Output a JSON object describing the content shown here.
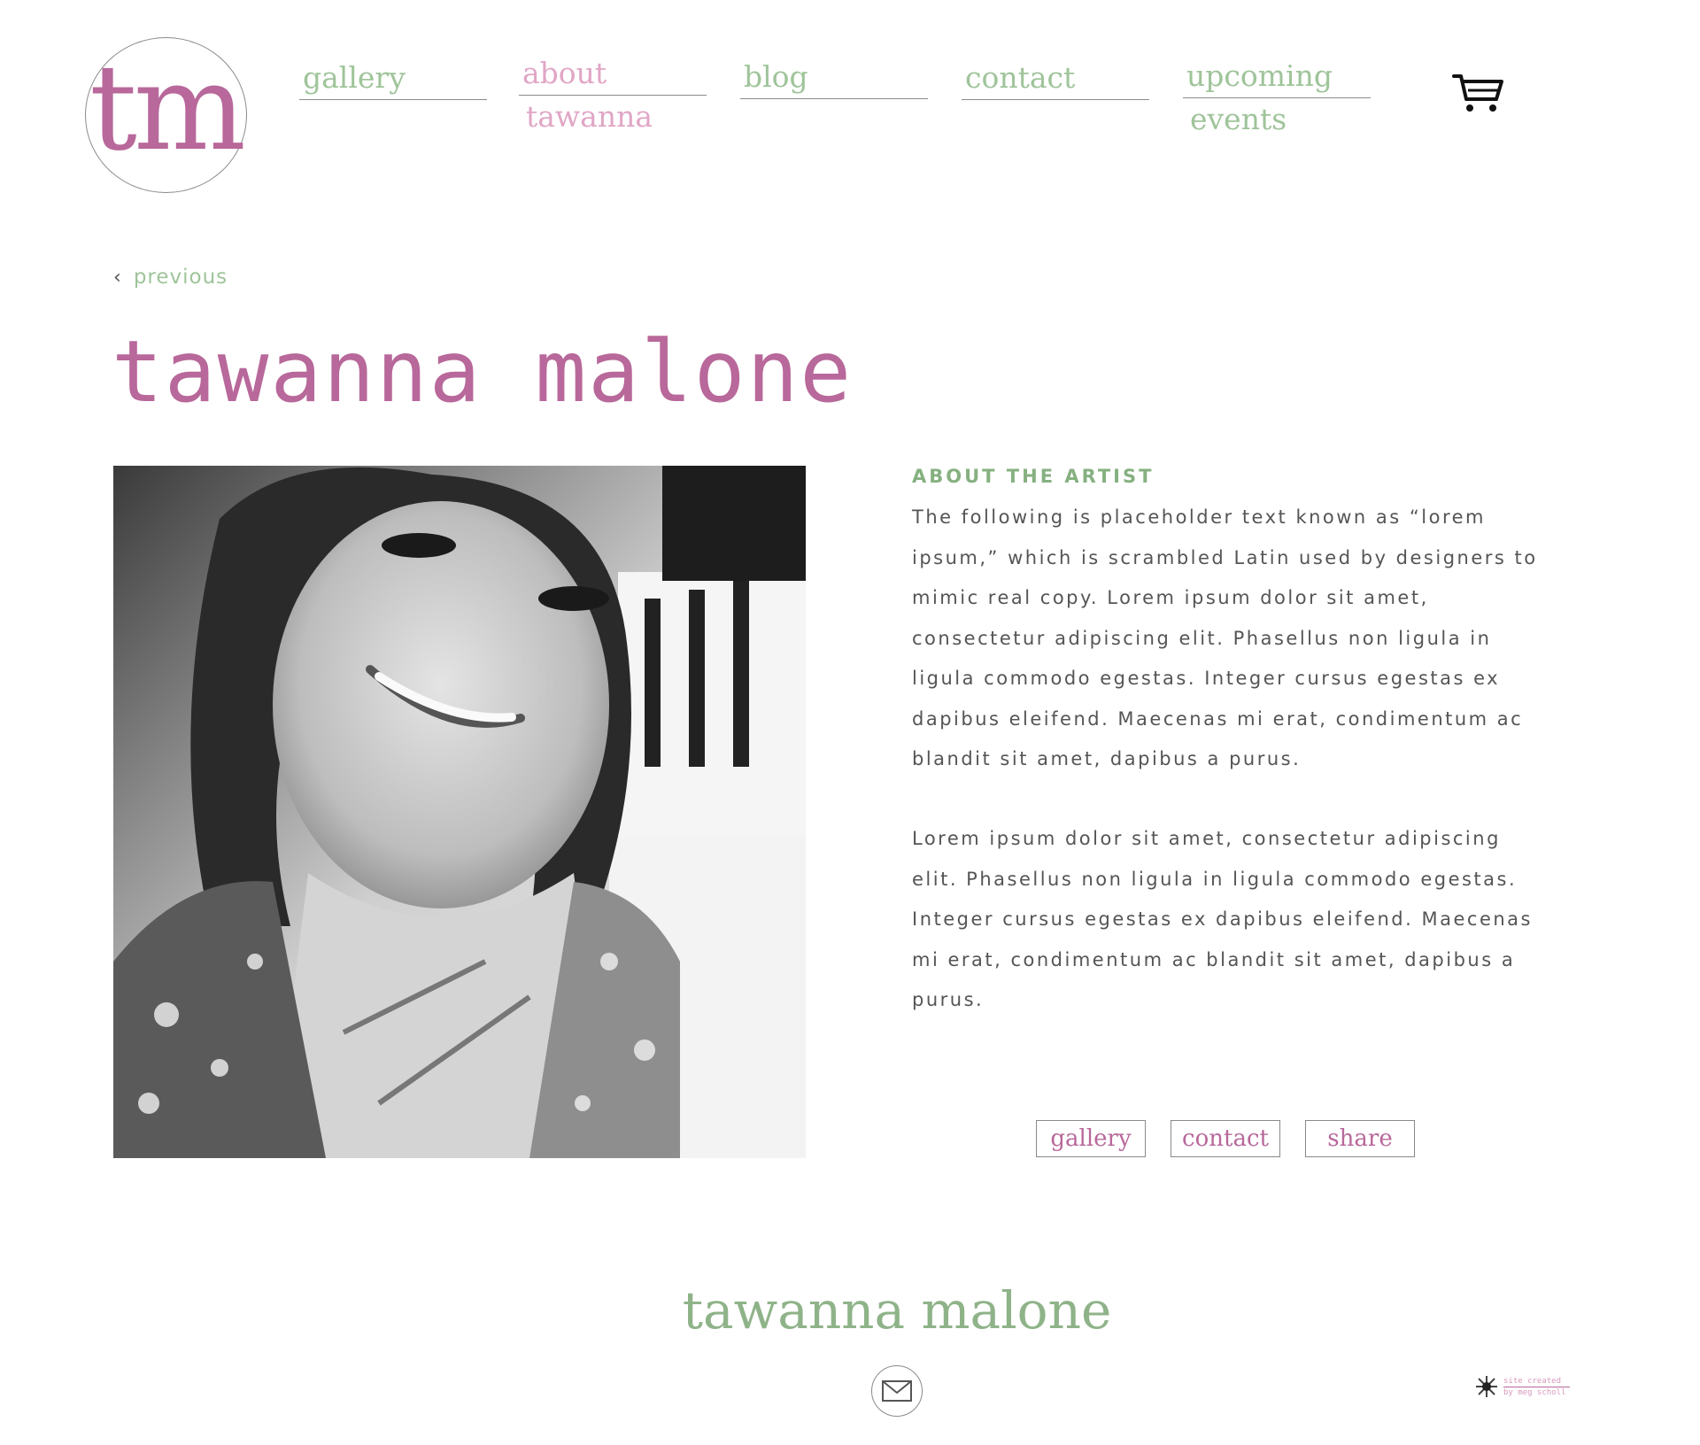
{
  "logo": {
    "text": "tm"
  },
  "nav": {
    "gallery": {
      "line1": "gallery"
    },
    "about": {
      "line1": "about",
      "line2": "tawanna"
    },
    "blog": {
      "line1": "blog"
    },
    "contact": {
      "line1": "contact"
    },
    "upcoming": {
      "line1": "upcoming",
      "line2": "events"
    }
  },
  "cart_icon": "shopping-cart-icon",
  "previous": {
    "label": "previous"
  },
  "page": {
    "title": "tawanna malone"
  },
  "about": {
    "heading": "ABOUT THE ARTIST",
    "paragraphs": [
      "The following is placeholder text known as “lorem ipsum,” which is scrambled Latin used by designers to mimic real copy. Lorem ipsum dolor sit amet, consectetur adipiscing elit. Phasellus non ligula in ligula commodo egestas. Integer cursus egestas ex dapibus eleifend. Maecenas mi erat, condimentum ac blandit sit amet, dapibus a purus.",
      "Lorem ipsum dolor sit amet, consectetur adipiscing elit. Phasellus non ligula in ligula commodo egestas. Integer cursus egestas ex dapibus eleifend. Maecenas mi erat, condimentum ac blandit sit amet, dapibus a purus."
    ]
  },
  "buttons": {
    "gallery": "gallery",
    "contact": "contact",
    "share": "share"
  },
  "footer": {
    "name": "tawanna malone",
    "credit_line1": "site created",
    "credit_line2": "by meg scholl"
  },
  "colors": {
    "pink": "#b8689a",
    "light_pink": "#e1a6c6",
    "green": "#9fc49a",
    "text_gray": "#555555"
  }
}
